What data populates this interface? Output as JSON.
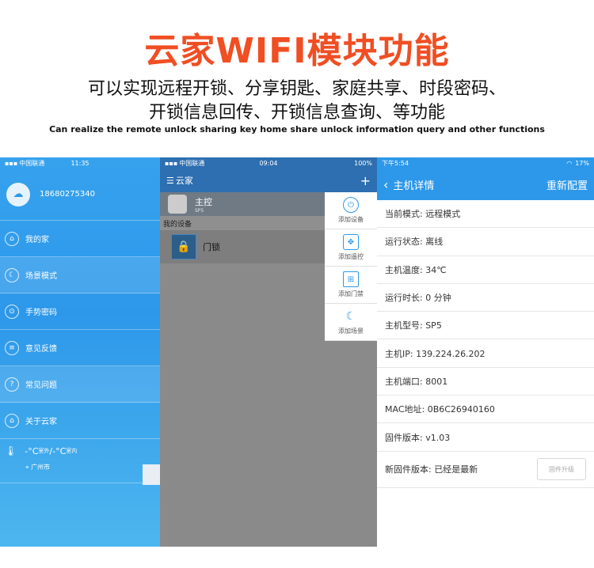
{
  "header": {
    "title": "云家WIFI模块功能",
    "subtitle_line1": "可以实现远程开锁、分享钥匙、家庭共享、时段密码、",
    "subtitle_line2": "开锁信息回传、开锁信息查询、等功能",
    "english": "Can realize the remote unlock sharing key home share unlock information query and other functions"
  },
  "screen1": {
    "status": {
      "carrier": "中国联通",
      "time": "11:35"
    },
    "phone": "18680275340",
    "menu": [
      {
        "label": "我的家",
        "icon": "home-icon",
        "glyph": "⌂"
      },
      {
        "label": "场景模式",
        "icon": "moon-icon",
        "glyph": "☾"
      },
      {
        "label": "手势密码",
        "icon": "lock-icon",
        "glyph": "⊙"
      },
      {
        "label": "意见反馈",
        "icon": "feedback-icon",
        "glyph": "≡"
      },
      {
        "label": "常见问题",
        "icon": "question-icon",
        "glyph": "?"
      },
      {
        "label": "关于云家",
        "icon": "about-icon",
        "glyph": "⌂"
      }
    ],
    "weather": {
      "temp_out": "-°C",
      "out_label": "室外",
      "sep": "/",
      "temp_in": "-°C",
      "in_label": "室内",
      "city": "广州市"
    }
  },
  "screen2": {
    "status": {
      "carrier": "中国联通",
      "time": "09:04",
      "battery": "100%"
    },
    "title": "云家",
    "main_device": {
      "name": "主控",
      "sub": "SP5"
    },
    "section": "我的设备",
    "device": "门锁",
    "menu": [
      {
        "label": "添加设备",
        "icon": "power-icon",
        "glyph": "⏻"
      },
      {
        "label": "添加遥控",
        "icon": "remote-icon",
        "glyph": "✥"
      },
      {
        "label": "添加门禁",
        "icon": "door-icon",
        "glyph": "⊞"
      },
      {
        "label": "添加场景",
        "icon": "scene-moon-icon",
        "glyph": "☾"
      }
    ]
  },
  "screen3": {
    "status": {
      "time": "下午5:54",
      "battery": "17%"
    },
    "title": "主机详情",
    "action": "重新配置",
    "rows": [
      "当前模式: 远程模式",
      "运行状态: 离线",
      "主机温度: 34℃",
      "运行时长: 0 分钟",
      "主机型号: SP5",
      "主机IP: 139.224.26.202",
      "主机端口: 8001",
      "MAC地址: 0B6C26940160",
      "固件版本: v1.03"
    ],
    "last_row": "新固件版本: 已经是最新",
    "upgrade_button": "固件升级"
  }
}
